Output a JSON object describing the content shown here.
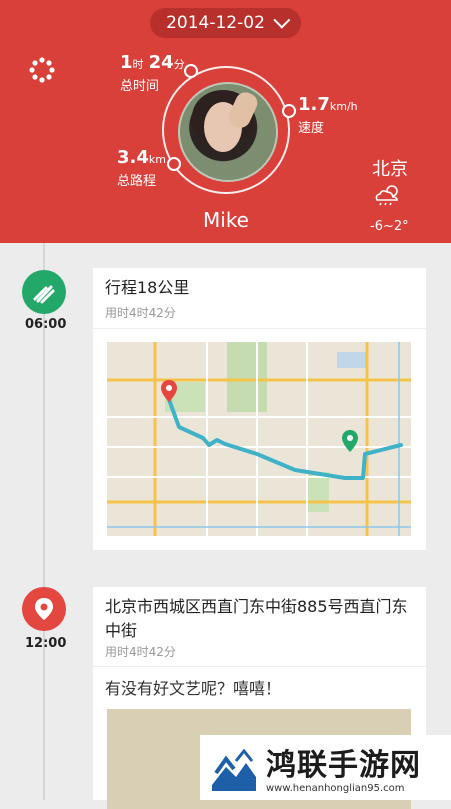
{
  "header": {
    "date": "2014-12-02",
    "name": "Mike",
    "city": "北京",
    "temp": "-6~2°",
    "stats": {
      "time": {
        "hours": "1",
        "hours_unit": "时",
        "minutes": "24",
        "minutes_unit": "分",
        "label": "总时间"
      },
      "speed": {
        "value": "1.7",
        "unit": "km/h",
        "label": "速度"
      },
      "distance": {
        "value": "3.4",
        "unit": "km",
        "label": "总路程"
      }
    }
  },
  "timeline": [
    {
      "time": "06:00",
      "title": "行程18公里",
      "sub": "用时4时42分",
      "icon": "route-icon",
      "color": "#23a86a"
    },
    {
      "time": "12:00",
      "title": "北京市西城区西直门东中街885号西直门东中街",
      "sub": "用时4时42分",
      "note": "有没有好文艺呢？嘻嘻！",
      "icon": "location-pin-icon",
      "color": "#e4473f"
    }
  ],
  "watermark": {
    "text": "鸿联手游网",
    "url": "www.henanhonglian95.com"
  },
  "colors": {
    "header": "#d9403a",
    "route": "#3fb2c8",
    "green": "#23a86a",
    "red": "#e4473f"
  }
}
